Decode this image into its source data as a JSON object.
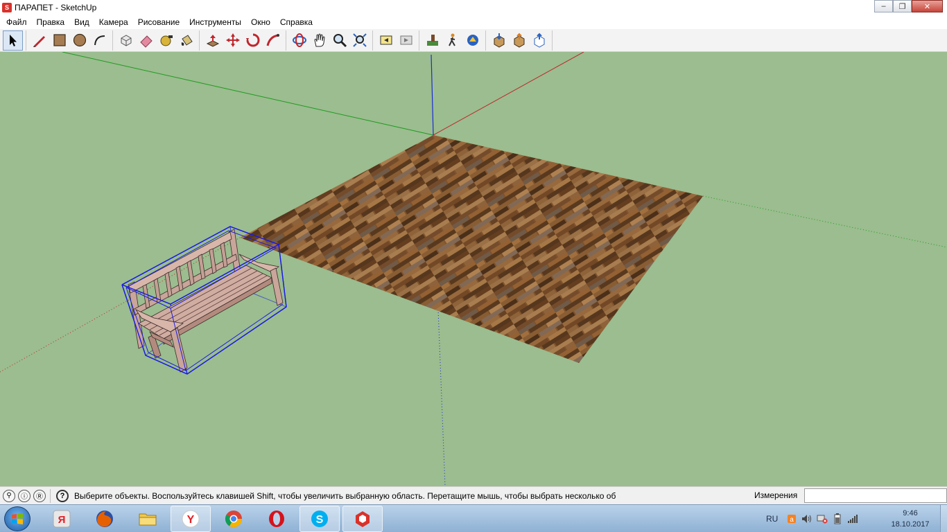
{
  "window": {
    "title": "ПАРАПЕТ - SketchUp",
    "app_icon": "sketchup-logo-icon",
    "controls": [
      "minimize-icon",
      "maximize-icon",
      "close-icon"
    ]
  },
  "menu": {
    "items": [
      "Файл",
      "Правка",
      "Вид",
      "Камера",
      "Рисование",
      "Инструменты",
      "Окно",
      "Справка"
    ]
  },
  "toolbar": {
    "groups": [
      [
        "select-arrow-icon"
      ],
      [
        "pencil-line-icon",
        "rectangle-icon",
        "circle-icon",
        "arc-icon"
      ],
      [
        "make-component-icon",
        "eraser-icon",
        "tape-measure-icon",
        "paint-bucket-icon"
      ],
      [
        "push-pull-icon",
        "move-icon",
        "rotate-icon",
        "follow-me-icon"
      ],
      [
        "orbit-icon",
        "pan-icon",
        "zoom-icon",
        "zoom-extents-icon"
      ],
      [
        "previous-view-icon",
        "next-view-icon"
      ],
      [
        "position-camera-icon",
        "walk-icon",
        "look-around-icon"
      ],
      [
        "get-models-icon",
        "share-model-icon",
        "share-component-icon"
      ]
    ]
  },
  "statusbar": {
    "icons": [
      "geo-location-icon",
      "credits-icon",
      "sign-in-icon"
    ],
    "help_icon": "help-icon",
    "message": "Выберите объекты. Воспользуйтесь клавишей Shift, чтобы увеличить выбранную область. Перетащите мышь, чтобы выбрать несколько об",
    "measure_label": "Измерения",
    "measure_value": ""
  },
  "taskbar": {
    "apps": [
      "yandex-icon",
      "firefox-icon",
      "file-explorer-icon",
      "yandex-browser-icon",
      "chrome-icon",
      "opera-icon",
      "skype-icon",
      "sketchup-icon"
    ],
    "language": "RU",
    "tray_icons": [
      "avast-icon",
      "volume-icon",
      "network-disconnected-icon",
      "battery-icon",
      "signal-icon"
    ],
    "time": "9:46",
    "date": "18.10.2017"
  },
  "colors": {
    "sky_ground": "#9bbd8f",
    "axis_red": "#c0262d",
    "axis_green": "#1e9a1e",
    "axis_blue": "#1b2ad6",
    "selection_blue": "#1a1ae6",
    "wood_light": "#a87c4e",
    "wood_dark": "#5b3a1e",
    "bench_wood": "#c9a59a"
  }
}
